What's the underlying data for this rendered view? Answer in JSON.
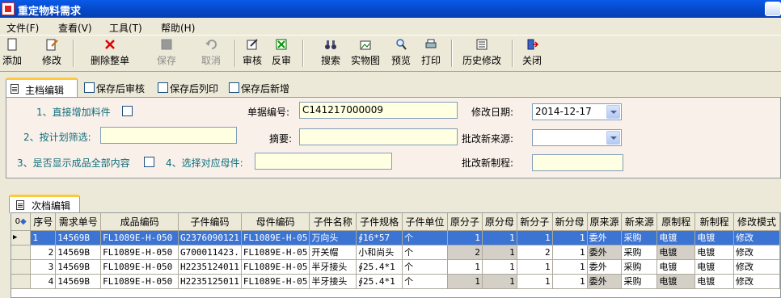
{
  "window": {
    "title": "重定物料需求"
  },
  "menu": [
    "文件(F)",
    "查看(V)",
    "工具(T)",
    "帮助(H)"
  ],
  "toolbar": {
    "add": "添加",
    "edit": "修改",
    "delete_all": "删除整单",
    "save": "保存",
    "cancel": "取消",
    "audit": "审核",
    "unaudit": "反审",
    "search": "搜索",
    "object_view": "实物图",
    "preview": "预览",
    "print": "打印",
    "history": "历史修改",
    "close": "关闭"
  },
  "main_tab": {
    "label": "主档编辑",
    "options": [
      "保存后审核",
      "保存后列印",
      "保存后新增"
    ]
  },
  "form": {
    "direct_add_label": "1、直接增加料件",
    "plan_filter_label": "2、按计划筛选:",
    "plan_filter_value": "",
    "show_all_label": "3、是否显示成品全部内容",
    "select_parent_label": "4、选择对应母件:",
    "select_parent_value": "",
    "doc_no_label": "单据编号:",
    "doc_no_value": "C141217000009",
    "summary_label": "摘要:",
    "summary_value": "",
    "modify_date_label": "修改日期:",
    "modify_date_value": "2014-12-17",
    "batch_source_label": "批改新来源:",
    "batch_source_value": "",
    "batch_process_label": "批改新制程:",
    "batch_process_value": ""
  },
  "sub_tab": {
    "label": "次档编辑"
  },
  "grid": {
    "columns": [
      "序号",
      "需求单号",
      "成品编码",
      "子件编码",
      "母件编码",
      "子件名称",
      "子件规格",
      "子件单位",
      "原分子",
      "原分母",
      "新分子",
      "新分母",
      "原来源",
      "新来源",
      "原制程",
      "新制程",
      "修改模式"
    ],
    "rows": [
      [
        "1",
        "14569B",
        "FL1089E-H-050",
        "G2376090121",
        "FL1089E-H-05",
        "万向头",
        "∮16*57",
        "个",
        "1",
        "1",
        "1",
        "1",
        "委外",
        "采购",
        "电镀",
        "电镀",
        "修改"
      ],
      [
        "2",
        "14569B",
        "FL1089E-H-050",
        "G700011423.",
        "FL1089E-H-05",
        "开关帽",
        "小和尚头",
        "个",
        "2",
        "1",
        "2",
        "1",
        "委外",
        "采购",
        "电镀",
        "电镀",
        "修改"
      ],
      [
        "3",
        "14569B",
        "FL1089E-H-050",
        "H2235124011",
        "FL1089E-H-05",
        "半牙接头",
        "∮25.4*1",
        "个",
        "1",
        "1",
        "1",
        "1",
        "委外",
        "采购",
        "电镀",
        "电镀",
        "修改"
      ],
      [
        "4",
        "14569B",
        "FL1089E-H-050",
        "H2235125011",
        "FL1089E-H-05",
        "半牙接头",
        "∮25.4*1",
        "个",
        "1",
        "1",
        "1",
        "1",
        "委外",
        "采购",
        "电镀",
        "电镀",
        "修改"
      ]
    ]
  },
  "colors": {
    "accent": "#0a5be8",
    "selection": "#3c74d4",
    "input_bg": "#ffffe1",
    "label_teal": "#0f6f7a"
  }
}
